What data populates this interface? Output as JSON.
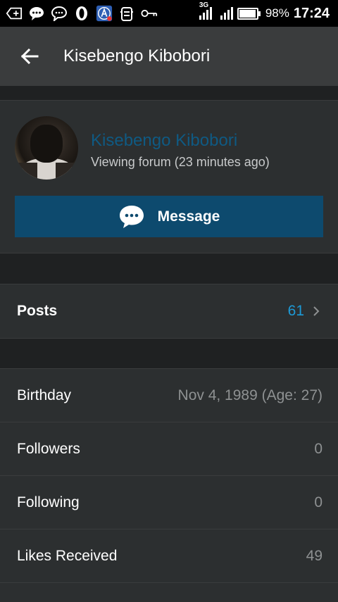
{
  "status_bar": {
    "battery_percent": "98%",
    "time": "17:24",
    "network": "3G",
    "icons": [
      "add-box-icon",
      "chat-bubble-icon",
      "chat-outline-icon",
      "opera-icon",
      "app-a-icon",
      "robot-icon",
      "key-icon",
      "signal-icon",
      "signal-icon",
      "battery-icon"
    ]
  },
  "app_bar": {
    "title": "Kisebengo Kibobori",
    "back_icon": "arrow-back-icon"
  },
  "profile": {
    "name": "Kisebengo Kibobori",
    "status": "Viewing forum (23 minutes ago)",
    "name_color": "#0f5a83",
    "message_button": {
      "label": "Message",
      "icon": "chat-bubble-icon",
      "color": "#0d4a6e"
    }
  },
  "posts": {
    "label": "Posts",
    "count": "61",
    "count_color": "#1d9ad6"
  },
  "info": [
    {
      "label": "Birthday",
      "value": "Nov 4, 1989 (Age: 27)"
    },
    {
      "label": "Followers",
      "value": "0"
    },
    {
      "label": "Following",
      "value": "0"
    },
    {
      "label": "Likes Received",
      "value": "49"
    }
  ]
}
